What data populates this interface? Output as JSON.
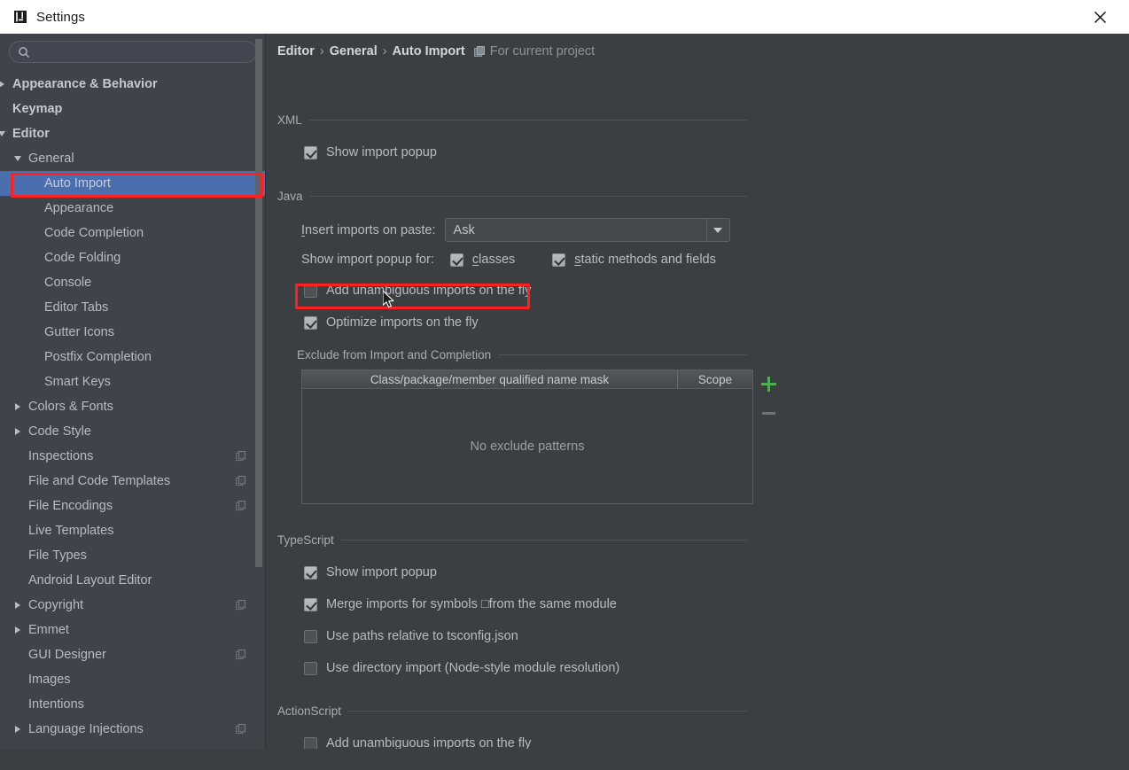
{
  "window": {
    "title": "Settings",
    "logo_icon": "intellij-idea-logo-icon",
    "close_icon": "close-icon"
  },
  "sidebar": {
    "search": {
      "value": "",
      "placeholder": "",
      "icon": "search-icon"
    },
    "items": [
      {
        "label": "Appearance & Behavior",
        "indent": 0,
        "arrow": "right",
        "bold": true,
        "selected": false,
        "project_icon": false
      },
      {
        "label": "Keymap",
        "indent": 0,
        "arrow": "none",
        "bold": true,
        "selected": false,
        "project_icon": false
      },
      {
        "label": "Editor",
        "indent": 0,
        "arrow": "down",
        "bold": true,
        "selected": false,
        "project_icon": false
      },
      {
        "label": "General",
        "indent": 1,
        "arrow": "down",
        "bold": false,
        "selected": false,
        "project_icon": false
      },
      {
        "label": "Auto Import",
        "indent": 2,
        "arrow": "none",
        "bold": false,
        "selected": true,
        "project_icon": false
      },
      {
        "label": "Appearance",
        "indent": 2,
        "arrow": "none",
        "bold": false,
        "selected": false,
        "project_icon": false
      },
      {
        "label": "Code Completion",
        "indent": 2,
        "arrow": "none",
        "bold": false,
        "selected": false,
        "project_icon": false
      },
      {
        "label": "Code Folding",
        "indent": 2,
        "arrow": "none",
        "bold": false,
        "selected": false,
        "project_icon": false
      },
      {
        "label": "Console",
        "indent": 2,
        "arrow": "none",
        "bold": false,
        "selected": false,
        "project_icon": false
      },
      {
        "label": "Editor Tabs",
        "indent": 2,
        "arrow": "none",
        "bold": false,
        "selected": false,
        "project_icon": false
      },
      {
        "label": "Gutter Icons",
        "indent": 2,
        "arrow": "none",
        "bold": false,
        "selected": false,
        "project_icon": false
      },
      {
        "label": "Postfix Completion",
        "indent": 2,
        "arrow": "none",
        "bold": false,
        "selected": false,
        "project_icon": false
      },
      {
        "label": "Smart Keys",
        "indent": 2,
        "arrow": "none",
        "bold": false,
        "selected": false,
        "project_icon": false
      },
      {
        "label": "Colors & Fonts",
        "indent": 1,
        "arrow": "right",
        "bold": false,
        "selected": false,
        "project_icon": false
      },
      {
        "label": "Code Style",
        "indent": 1,
        "arrow": "right",
        "bold": false,
        "selected": false,
        "project_icon": false
      },
      {
        "label": "Inspections",
        "indent": 1,
        "arrow": "none",
        "bold": false,
        "selected": false,
        "project_icon": true
      },
      {
        "label": "File and Code Templates",
        "indent": 1,
        "arrow": "none",
        "bold": false,
        "selected": false,
        "project_icon": true
      },
      {
        "label": "File Encodings",
        "indent": 1,
        "arrow": "none",
        "bold": false,
        "selected": false,
        "project_icon": true
      },
      {
        "label": "Live Templates",
        "indent": 1,
        "arrow": "none",
        "bold": false,
        "selected": false,
        "project_icon": false
      },
      {
        "label": "File Types",
        "indent": 1,
        "arrow": "none",
        "bold": false,
        "selected": false,
        "project_icon": false
      },
      {
        "label": "Android Layout Editor",
        "indent": 1,
        "arrow": "none",
        "bold": false,
        "selected": false,
        "project_icon": false
      },
      {
        "label": "Copyright",
        "indent": 1,
        "arrow": "right",
        "bold": false,
        "selected": false,
        "project_icon": true
      },
      {
        "label": "Emmet",
        "indent": 1,
        "arrow": "right",
        "bold": false,
        "selected": false,
        "project_icon": false
      },
      {
        "label": "GUI Designer",
        "indent": 1,
        "arrow": "none",
        "bold": false,
        "selected": false,
        "project_icon": true
      },
      {
        "label": "Images",
        "indent": 1,
        "arrow": "none",
        "bold": false,
        "selected": false,
        "project_icon": false
      },
      {
        "label": "Intentions",
        "indent": 1,
        "arrow": "none",
        "bold": false,
        "selected": false,
        "project_icon": false
      },
      {
        "label": "Language Injections",
        "indent": 1,
        "arrow": "right",
        "bold": false,
        "selected": false,
        "project_icon": true
      }
    ]
  },
  "breadcrumb": {
    "segments": [
      "Editor",
      "General",
      "Auto Import"
    ],
    "separator": "›",
    "project_icon": "project-scope-icon",
    "note": "For current project"
  },
  "sections": {
    "xml": {
      "title": "XML",
      "show_import_popup": {
        "label": "Show import popup",
        "checked": true
      }
    },
    "java": {
      "title": "Java",
      "insert_imports_label": "Insert imports on paste:",
      "insert_imports_mnemonic": "I",
      "insert_imports_value": "Ask",
      "show_popup_for_label": "Show import popup for:",
      "classes": {
        "label": "classes",
        "mnemonic": "c",
        "checked": true
      },
      "static_methods": {
        "label": "static methods and fields",
        "mnemonic": "s",
        "checked": true
      },
      "add_unambiguous": {
        "label": "Add unambiguous imports on the fly",
        "checked": false
      },
      "optimize_imports": {
        "label": "Optimize imports on the fly",
        "checked": true
      },
      "exclude": {
        "title": "Exclude from Import and Completion",
        "columns": [
          "Class/package/member qualified name mask",
          "Scope"
        ],
        "empty_text": "No exclude patterns",
        "rows": [],
        "add_button": "+",
        "remove_button": "−"
      }
    },
    "typescript": {
      "title": "TypeScript",
      "options": [
        {
          "label": "Show import popup",
          "checked": true
        },
        {
          "label": "Merge imports for symbols □from the same module",
          "checked": true
        },
        {
          "label": "Use paths relative to tsconfig.json",
          "checked": false
        },
        {
          "label": "Use directory import (Node-style module resolution)",
          "checked": false
        }
      ]
    },
    "actionscript": {
      "title": "ActionScript",
      "options": [
        {
          "label": "Add unambiguous imports on the fly",
          "checked": false
        }
      ]
    }
  },
  "annotations": {
    "color": "#ff2020",
    "boxes": [
      "sidebar-auto-import",
      "optimize-imports-on-the-fly"
    ]
  },
  "colors": {
    "titlebar_bg": "#ffffff",
    "sidebar_bg": "#3f434a",
    "content_bg": "#3c3f41",
    "selection_blue": "#4b6eaf",
    "accent_green": "#4caf50",
    "annotation_red": "#ff2020",
    "text_primary": "#b8bcc0"
  }
}
